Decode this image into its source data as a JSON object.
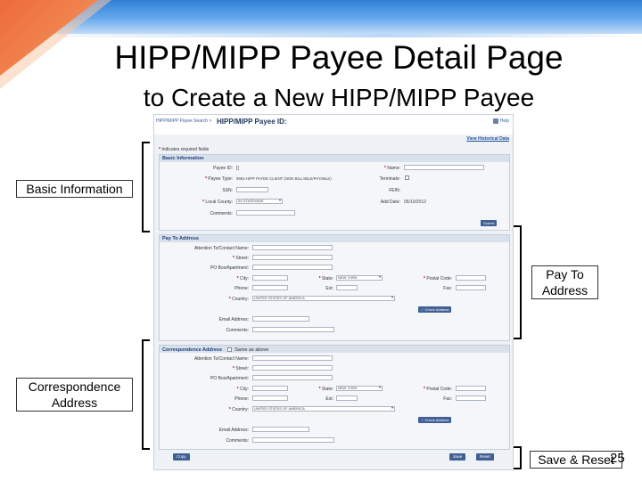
{
  "slide": {
    "title": "HIPP/MIPP Payee Detail Page",
    "subtitle": "to Create a New HIPP/MIPP Payee",
    "page_number": "25"
  },
  "callouts": {
    "basic": "Basic Information",
    "payto": "Pay To Address",
    "corr": "Correspondence Address",
    "save": "Save & Reset"
  },
  "screenshot": {
    "breadcrumb": "HIPP/MIPP Payee Search >",
    "page_title": "HIPP/MIPP Payee ID:",
    "help_label": "Help",
    "view_historical": "View Historical Data",
    "required_note": "Indicates required fields",
    "basic": {
      "header": "Basic Information",
      "payee_id_label": "Payee ID:",
      "payee_id_value": "[]",
      "payee_type_label": "Payee Type:",
      "payee_type_value": "9991-HIPP PAYEE CLIENT (NON BILLABLE/PAYABLE)",
      "ssn_label": "SSN:",
      "local_county_label": "Local County:",
      "local_county_value": "00-STATEWIDE",
      "comments_label": "Comments:",
      "name_label": "Name:",
      "terminate_label": "Terminate:",
      "fein_label": "FEIN:",
      "add_date_label": "Add Date:",
      "add_date_value": "05/10/2012",
      "submit": "Submit"
    },
    "payto": {
      "header": "Pay To Address",
      "attention_label": "Attention To/Contact Name:",
      "street_label": "Street:",
      "po_label": "PO Box/Apartment:",
      "city_label": "City:",
      "state_label": "State:",
      "state_value": "NEW YORK",
      "postal_label": "Postal Code:",
      "phone_label": "Phone:",
      "ext_label": "Ext:",
      "fax_label": "Fax:",
      "country_label": "Country:",
      "country_value": "UNITED STATES OF AMERICA",
      "check_address": "Check Address",
      "email_label": "Email Address:",
      "comments_label": "Comments:"
    },
    "corr": {
      "header": "Correspondence Address",
      "same_as_label": "Same as above",
      "attention_label": "Attention To/Contact Name:",
      "street_label": "Street:",
      "po_label": "PO Box/Apartment:",
      "city_label": "City:",
      "state_label": "State:",
      "state_value": "NEW YORK",
      "postal_label": "Postal Code:",
      "phone_label": "Phone:",
      "ext_label": "Ext:",
      "fax_label": "Fax:",
      "country_label": "Country:",
      "country_value": "UNITED STATES OF AMERICA",
      "check_address": "Check Address",
      "email_label": "Email Address:",
      "comments_label": "Comments:"
    },
    "buttons": {
      "copy": "Copy",
      "save": "Save",
      "reset": "Reset"
    }
  },
  "colors": {
    "accent_blue": "#2f7fd6",
    "accent_orange": "#ee6a3c",
    "panel_button": "#3f5f95"
  }
}
